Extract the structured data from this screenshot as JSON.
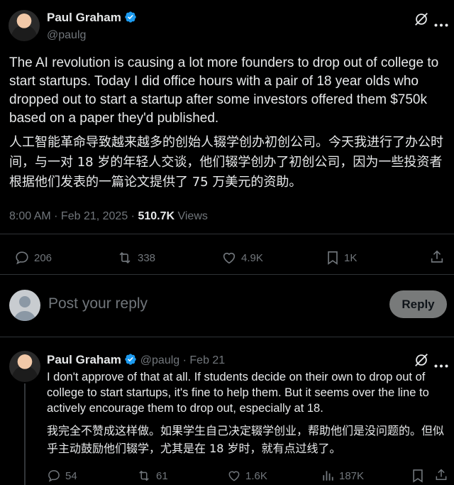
{
  "tweet": {
    "author_name": "Paul Graham",
    "author_handle": "@paulg",
    "text_en": "The AI revolution is causing a lot more founders to drop out of college to start startups. Today I did office hours with a pair of 18 year olds who dropped out to start a startup after some investors offered them $750k based on a paper they'd published.",
    "text_zh": "人工智能革命导致越来越多的创始人辍学创办初创公司。今天我进行了办公时间，与一对 18 岁的年轻人交谈，他们辍学创办了初创公司，因为一些投资者根据他们发表的一篇论文提供了 75 万美元的资助。",
    "time": "8:00 AM · Feb 21, 2025 · ",
    "views_count": "510.7K",
    "views_label": " Views",
    "replies": "206",
    "reposts": "338",
    "likes": "4.9K",
    "bookmarks": "1K"
  },
  "composer": {
    "placeholder": "Post your reply",
    "button_label": "Reply"
  },
  "reply": {
    "author_name": "Paul Graham",
    "author_handle": "@paulg",
    "date": " · Feb 21",
    "text_en": "I don't approve of that at all. If students decide on their own to drop out of college to start startups, it's fine to help them. But it seems over the line to actively encourage them to drop out, especially at 18.",
    "text_zh": "我完全不赞成这样做。如果学生自己决定辍学创业，帮助他们是没问题的。但似乎主动鼓励他们辍学，尤其是在 18 岁时，就有点过线了。",
    "replies": "54",
    "reposts": "61",
    "likes": "1.6K",
    "views": "187K"
  },
  "colors": {
    "verified": "#1d9bf0",
    "muted": "#71767b",
    "text": "#e7e9ea",
    "divider": "#2f3336"
  }
}
